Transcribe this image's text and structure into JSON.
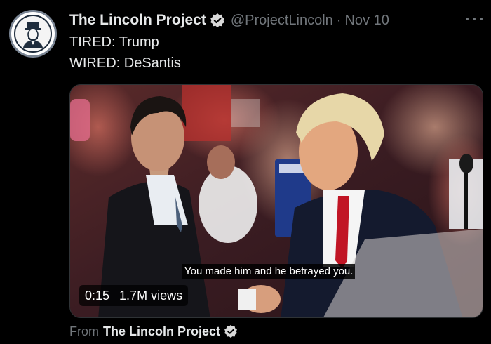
{
  "tweet": {
    "display_name": "The Lincoln Project",
    "handle": "@ProjectLincoln",
    "separator": "·",
    "date": "Nov 10",
    "text_lines": [
      "TIRED: Trump",
      "WIRED: DeSantis"
    ]
  },
  "video": {
    "caption": "You made him and he betrayed you.",
    "duration": "0:15",
    "views": "1.7M views"
  },
  "source": {
    "prefix": "From",
    "name": "The Lincoln Project"
  },
  "colors": {
    "background": "#000000",
    "text_primary": "#e7e9ea",
    "text_secondary": "#71767b",
    "verified_badge": "#d9d9d9"
  }
}
